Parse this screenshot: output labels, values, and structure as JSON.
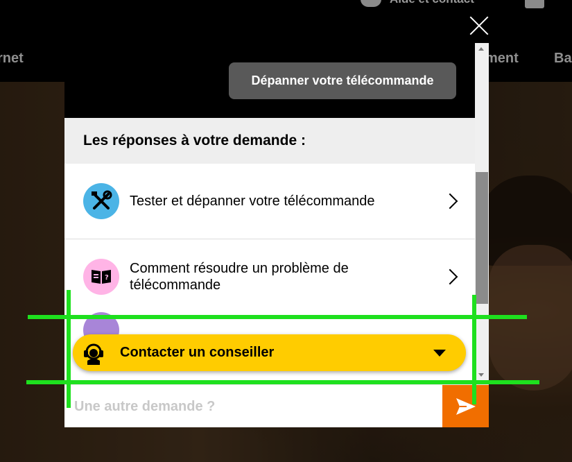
{
  "page": {
    "help_label": "Aide et contact",
    "nav_left": "rnet",
    "nav_right": "ment",
    "nav_far": "Ba"
  },
  "chat": {
    "bot_bubble": "Dépanner votre télécommande",
    "answers_title": "Les réponses à votre demande :",
    "items": [
      {
        "label": "Tester et dépanner votre télécommande",
        "icon": "tools-icon"
      },
      {
        "label": "Comment résoudre un problème de télécommande",
        "icon": "manual-book-icon"
      }
    ],
    "contact_button": "Contacter un conseiller",
    "input_placeholder": "Une autre demande ?",
    "send_icon": "paper-plane-icon"
  },
  "colors": {
    "accent_orange": "#f16e00",
    "accent_yellow": "#ffcc00",
    "icon_blue": "#4bb4e6",
    "icon_pink": "#ffb4e6",
    "overlay_guides": "#1ee01e"
  }
}
